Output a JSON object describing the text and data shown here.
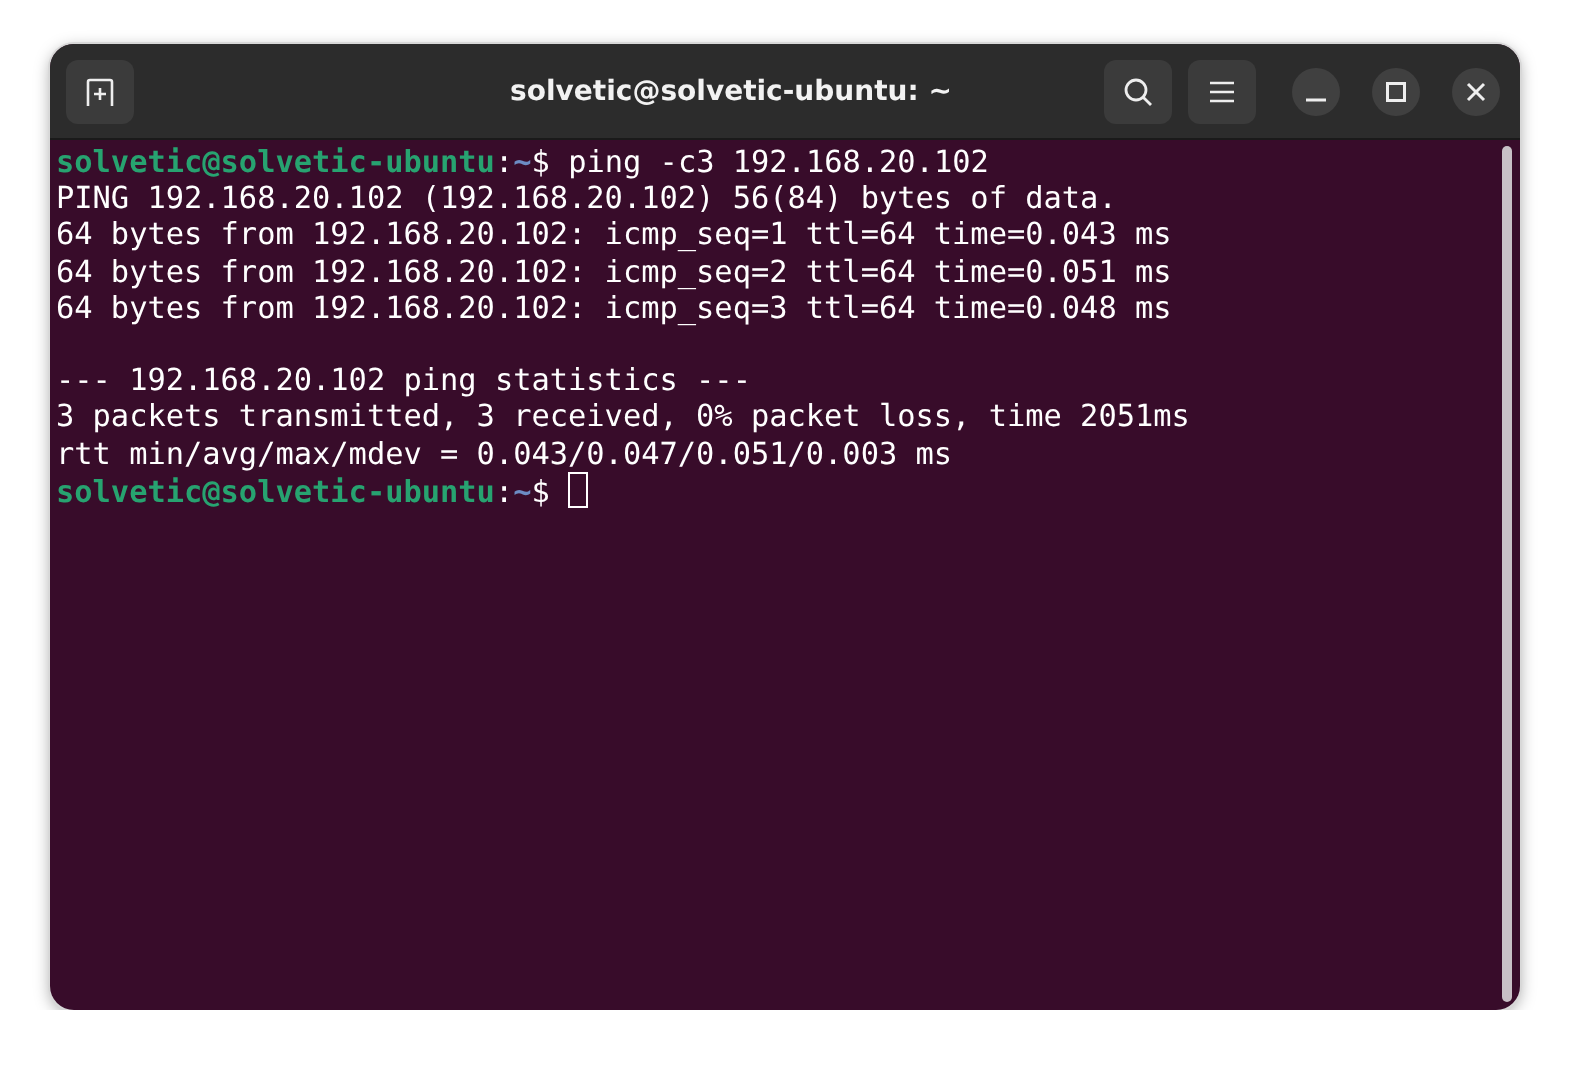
{
  "window": {
    "title": "solvetic@solvetic-ubuntu: ~"
  },
  "terminal": {
    "lines": [
      {
        "kind": "prompt",
        "user_host": "solvetic@solvetic-ubuntu",
        "separator": ":",
        "path": "~",
        "symbol": "$",
        "command": "ping -c3 192.168.20.102"
      },
      {
        "kind": "output",
        "text": "PING 192.168.20.102 (192.168.20.102) 56(84) bytes of data."
      },
      {
        "kind": "output",
        "text": "64 bytes from 192.168.20.102: icmp_seq=1 ttl=64 time=0.043 ms"
      },
      {
        "kind": "output",
        "text": "64 bytes from 192.168.20.102: icmp_seq=2 ttl=64 time=0.051 ms"
      },
      {
        "kind": "output",
        "text": "64 bytes from 192.168.20.102: icmp_seq=3 ttl=64 time=0.048 ms"
      },
      {
        "kind": "blank"
      },
      {
        "kind": "output",
        "text": "--- 192.168.20.102 ping statistics ---"
      },
      {
        "kind": "output",
        "text": "3 packets transmitted, 3 received, 0% packet loss, time 2051ms"
      },
      {
        "kind": "output",
        "text": "rtt min/avg/max/mdev = 0.043/0.047/0.051/0.003 ms"
      },
      {
        "kind": "prompt",
        "user_host": "solvetic@solvetic-ubuntu",
        "separator": ":",
        "path": "~",
        "symbol": "$",
        "cursor": true
      }
    ]
  }
}
